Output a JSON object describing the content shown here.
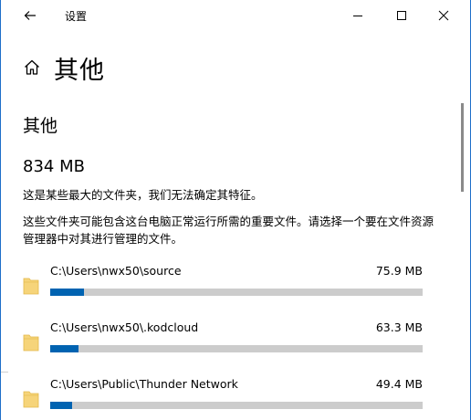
{
  "window": {
    "title": "设置",
    "controls": {
      "minimize": "minimize",
      "maximize": "maximize",
      "close": "close"
    }
  },
  "page": {
    "title": "其他"
  },
  "section": {
    "title": "其他",
    "total_size": "834 MB",
    "description_1": "这是某些最大的文件夹，我们无法确定其特征。",
    "description_2": "这些文件夹可能包含这台电脑正常运行所需的重要文件。请选择一个要在文件资源管理器中对其进行管理的文件。"
  },
  "folders": [
    {
      "path": "C:\\Users\\nwx50\\source",
      "size": "75.9 MB",
      "fraction": 0.09
    },
    {
      "path": "C:\\Users\\nwx50\\.kodcloud",
      "size": "63.3 MB",
      "fraction": 0.076
    },
    {
      "path": "C:\\Users\\Public\\Thunder Network",
      "size": "49.4 MB",
      "fraction": 0.059
    }
  ],
  "colors": {
    "accent": "#0063b1",
    "bar_track": "#cccccc",
    "window_border": "#1e6fc9",
    "folder": "#f6d47a"
  },
  "icons": [
    "back-arrow-icon",
    "minimize-icon",
    "maximize-icon",
    "close-icon",
    "home-icon",
    "folder-icon"
  ]
}
